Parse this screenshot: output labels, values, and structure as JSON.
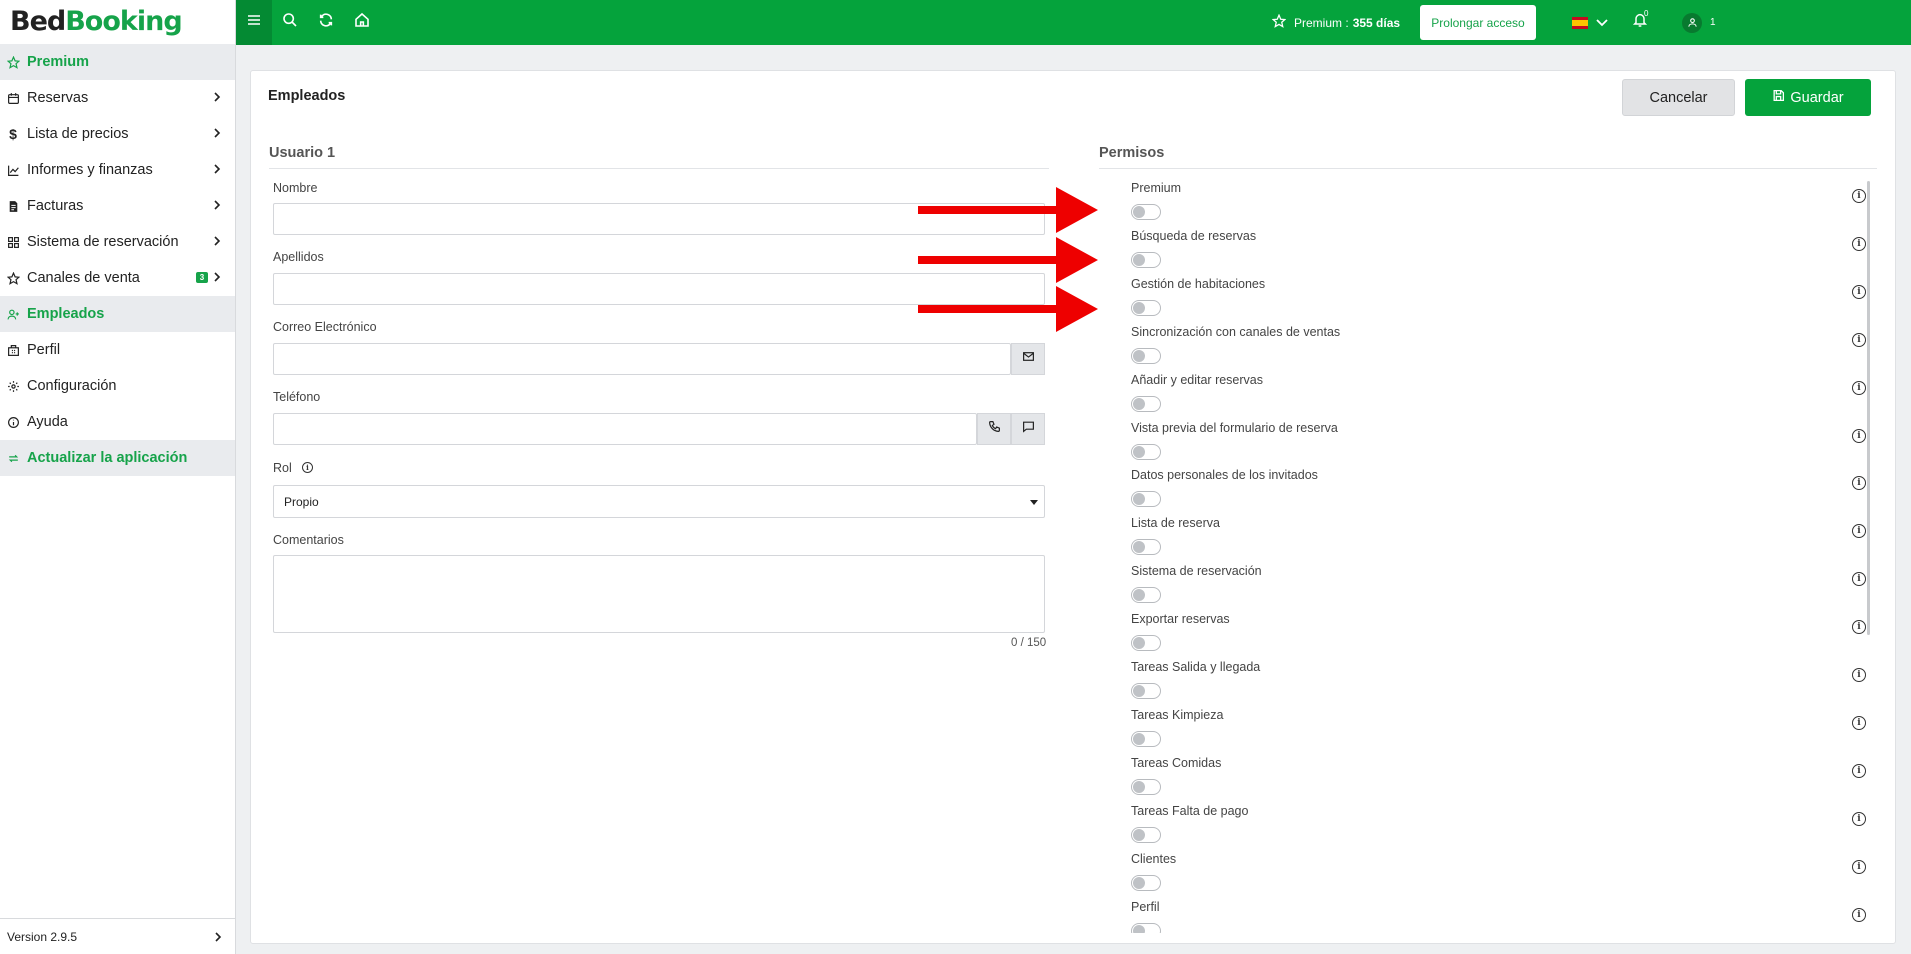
{
  "logo": {
    "part1": "Bed",
    "part2": "Booking"
  },
  "sidebar": {
    "items": [
      {
        "label": "Premium",
        "icon": "star-icon"
      },
      {
        "label": "Reservas",
        "icon": "calendar-icon"
      },
      {
        "label": "Lista de precios",
        "icon": "dollar-icon"
      },
      {
        "label": "Informes y finanzas",
        "icon": "chart-icon"
      },
      {
        "label": "Facturas",
        "icon": "invoice-icon"
      },
      {
        "label": "Sistema de reservación",
        "icon": "grid-icon"
      },
      {
        "label": "Canales de venta",
        "icon": "star-icon",
        "badge": "3"
      },
      {
        "label": "Empleados",
        "icon": "add-user-icon"
      },
      {
        "label": "Perfil",
        "icon": "building-icon"
      },
      {
        "label": "Configuración",
        "icon": "gear-icon"
      },
      {
        "label": "Ayuda",
        "icon": "info-icon"
      },
      {
        "label": "Actualizar la aplicación",
        "icon": "refresh-icon"
      }
    ],
    "version": "Version 2.9.5"
  },
  "topbar": {
    "premium_label": "Premium :",
    "premium_days": "355 días",
    "extend_label": "Prolongar acceso",
    "notification_count": "0",
    "user_label": "1"
  },
  "page": {
    "title": "Empleados",
    "cancel_label": "Cancelar",
    "save_label": "Guardar"
  },
  "user_form": {
    "section_title": "Usuario 1",
    "name_label": "Nombre",
    "surname_label": "Apellidos",
    "email_label": "Correo Electrónico",
    "phone_label": "Teléfono",
    "role_label": "Rol",
    "role_value": "Propio",
    "comments_label": "Comentarios",
    "comments_counter": "0 / 150"
  },
  "permissions": {
    "section_title": "Permisos",
    "items": [
      {
        "label": "Premium",
        "enabled": false
      },
      {
        "label": "Búsqueda de reservas",
        "enabled": false
      },
      {
        "label": "Gestión de habitaciones",
        "enabled": false
      },
      {
        "label": "Sincronización con canales de ventas",
        "enabled": false
      },
      {
        "label": "Añadir y editar reservas",
        "enabled": false
      },
      {
        "label": "Vista previa del formulario de reserva",
        "enabled": false
      },
      {
        "label": "Datos personales de los invitados",
        "enabled": false
      },
      {
        "label": "Lista de reserva",
        "enabled": false
      },
      {
        "label": "Sistema de reservación",
        "enabled": false
      },
      {
        "label": "Exportar reservas",
        "enabled": false
      },
      {
        "label": "Tareas Salida y llegada",
        "enabled": false
      },
      {
        "label": "Tareas Kimpieza",
        "enabled": false
      },
      {
        "label": "Tareas Comidas",
        "enabled": false
      },
      {
        "label": "Tareas Falta de pago",
        "enabled": false
      },
      {
        "label": "Clientes",
        "enabled": false
      },
      {
        "label": "Perfil",
        "enabled": false
      }
    ]
  },
  "colors": {
    "brand": "#05a33c",
    "arrow": "#ee0000"
  }
}
